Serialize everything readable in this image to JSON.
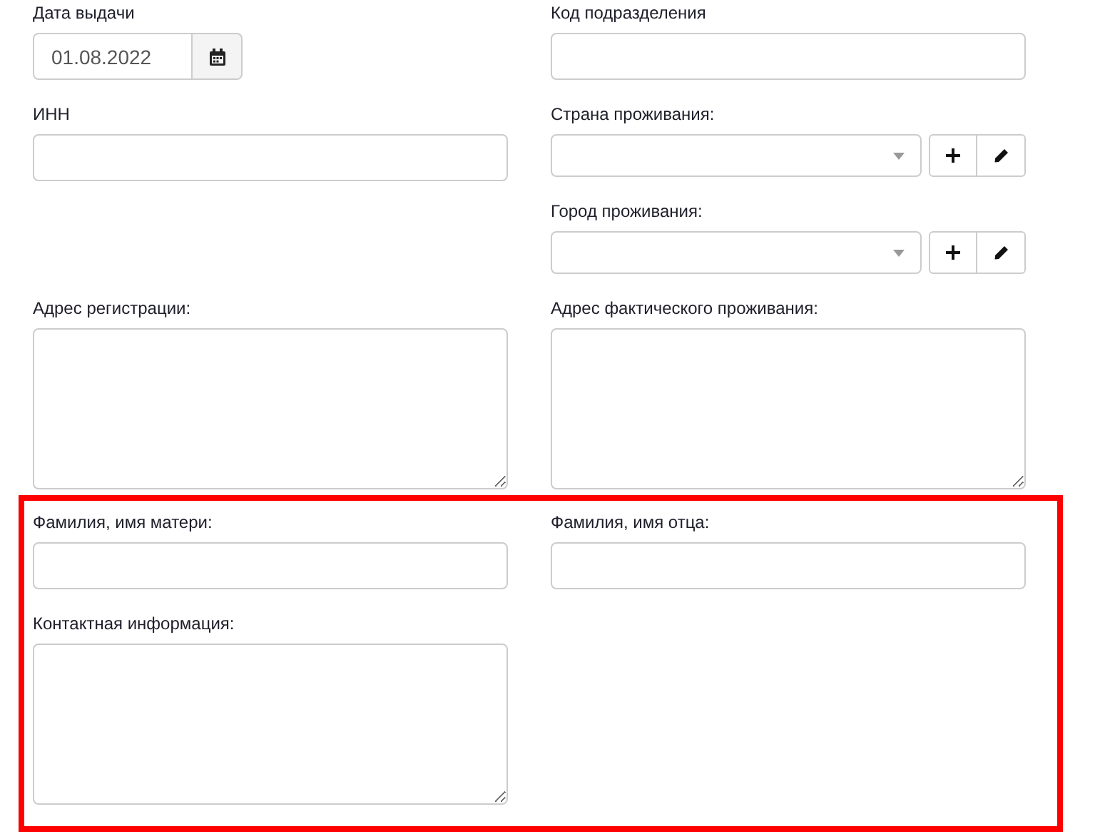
{
  "sections": [
    {
      "highlighted": false,
      "rows": [
        {
          "left": [
            {
              "kind": "date",
              "label": "Дата выдачи",
              "value": "01.08.2022"
            }
          ],
          "right": [
            {
              "kind": "text",
              "label": "Код подразделения"
            }
          ]
        },
        {
          "left": [
            {
              "kind": "text",
              "label": "ИНН"
            }
          ],
          "right": [
            {
              "kind": "select",
              "label": "Страна проживания:"
            },
            {
              "kind": "select",
              "label": "Город проживания:"
            }
          ]
        },
        {
          "left": [
            {
              "kind": "textarea",
              "label": "Адрес регистрации:"
            }
          ],
          "right": [
            {
              "kind": "textarea",
              "label": "Адрес фактического проживания:"
            }
          ]
        }
      ]
    },
    {
      "highlighted": true,
      "rows": [
        {
          "left": [
            {
              "kind": "text",
              "label": "Фамилия, имя матери:"
            }
          ],
          "right": [
            {
              "kind": "text",
              "label": "Фамилия, имя отца:"
            }
          ]
        },
        {
          "left": [
            {
              "kind": "textarea",
              "label": "Контактная информация:"
            }
          ]
        }
      ]
    }
  ]
}
